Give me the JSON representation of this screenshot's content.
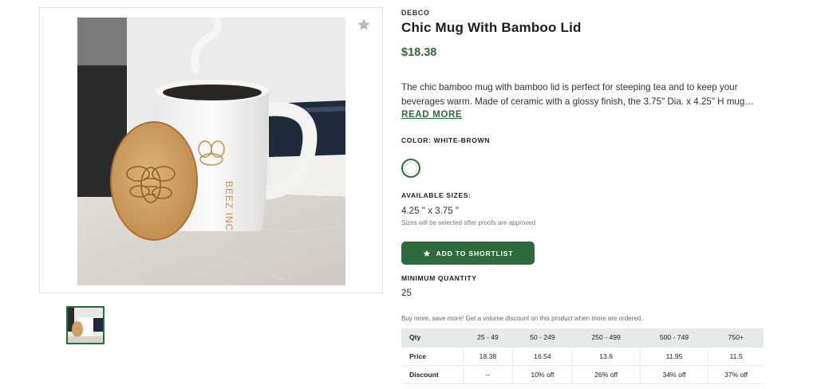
{
  "product": {
    "brand": "DEBCO",
    "title": "Chic Mug With Bamboo Lid",
    "price": "$18.38",
    "description": "The chic bamboo mug with bamboo lid is perfect for steeping tea and to keep your beverages warm. Made of ceramic with a glossy finish, the 3.75\" Dia. x 4.25\" H mug…",
    "read_more": "READ MORE",
    "mug_imprint": "BEEZ INC"
  },
  "color": {
    "label": "COLOR: WHITE-BROWN"
  },
  "sizes": {
    "label": "AVAILABLE SIZES:",
    "value": "4.25 \" x 3.75 \"",
    "note": "Sizes will be selected after proofs are approved"
  },
  "actions": {
    "shortlist_label": "ADD TO SHORTLIST"
  },
  "minimum_quantity": {
    "label": "MINIMUM QUANTITY",
    "value": "25"
  },
  "pricing": {
    "note": "Buy more, save more! Get a volume discount on this product when more are ordered.",
    "header": [
      "Qty",
      "25 - 49",
      "50 - 249",
      "250 - 499",
      "500 - 749",
      "750+"
    ],
    "price_row": [
      "Price",
      "18.38",
      "16.54",
      "13.6",
      "11.95",
      "11.5"
    ],
    "discount_row": [
      "Discount",
      "--",
      "10% off",
      "26% off",
      "34% off",
      "37% off"
    ]
  },
  "theme": {
    "accent": "#2e6b3c",
    "header_bg": "#e4ebe7"
  },
  "icons": {
    "favorite": "star-icon",
    "shortlist": "star-icon"
  }
}
